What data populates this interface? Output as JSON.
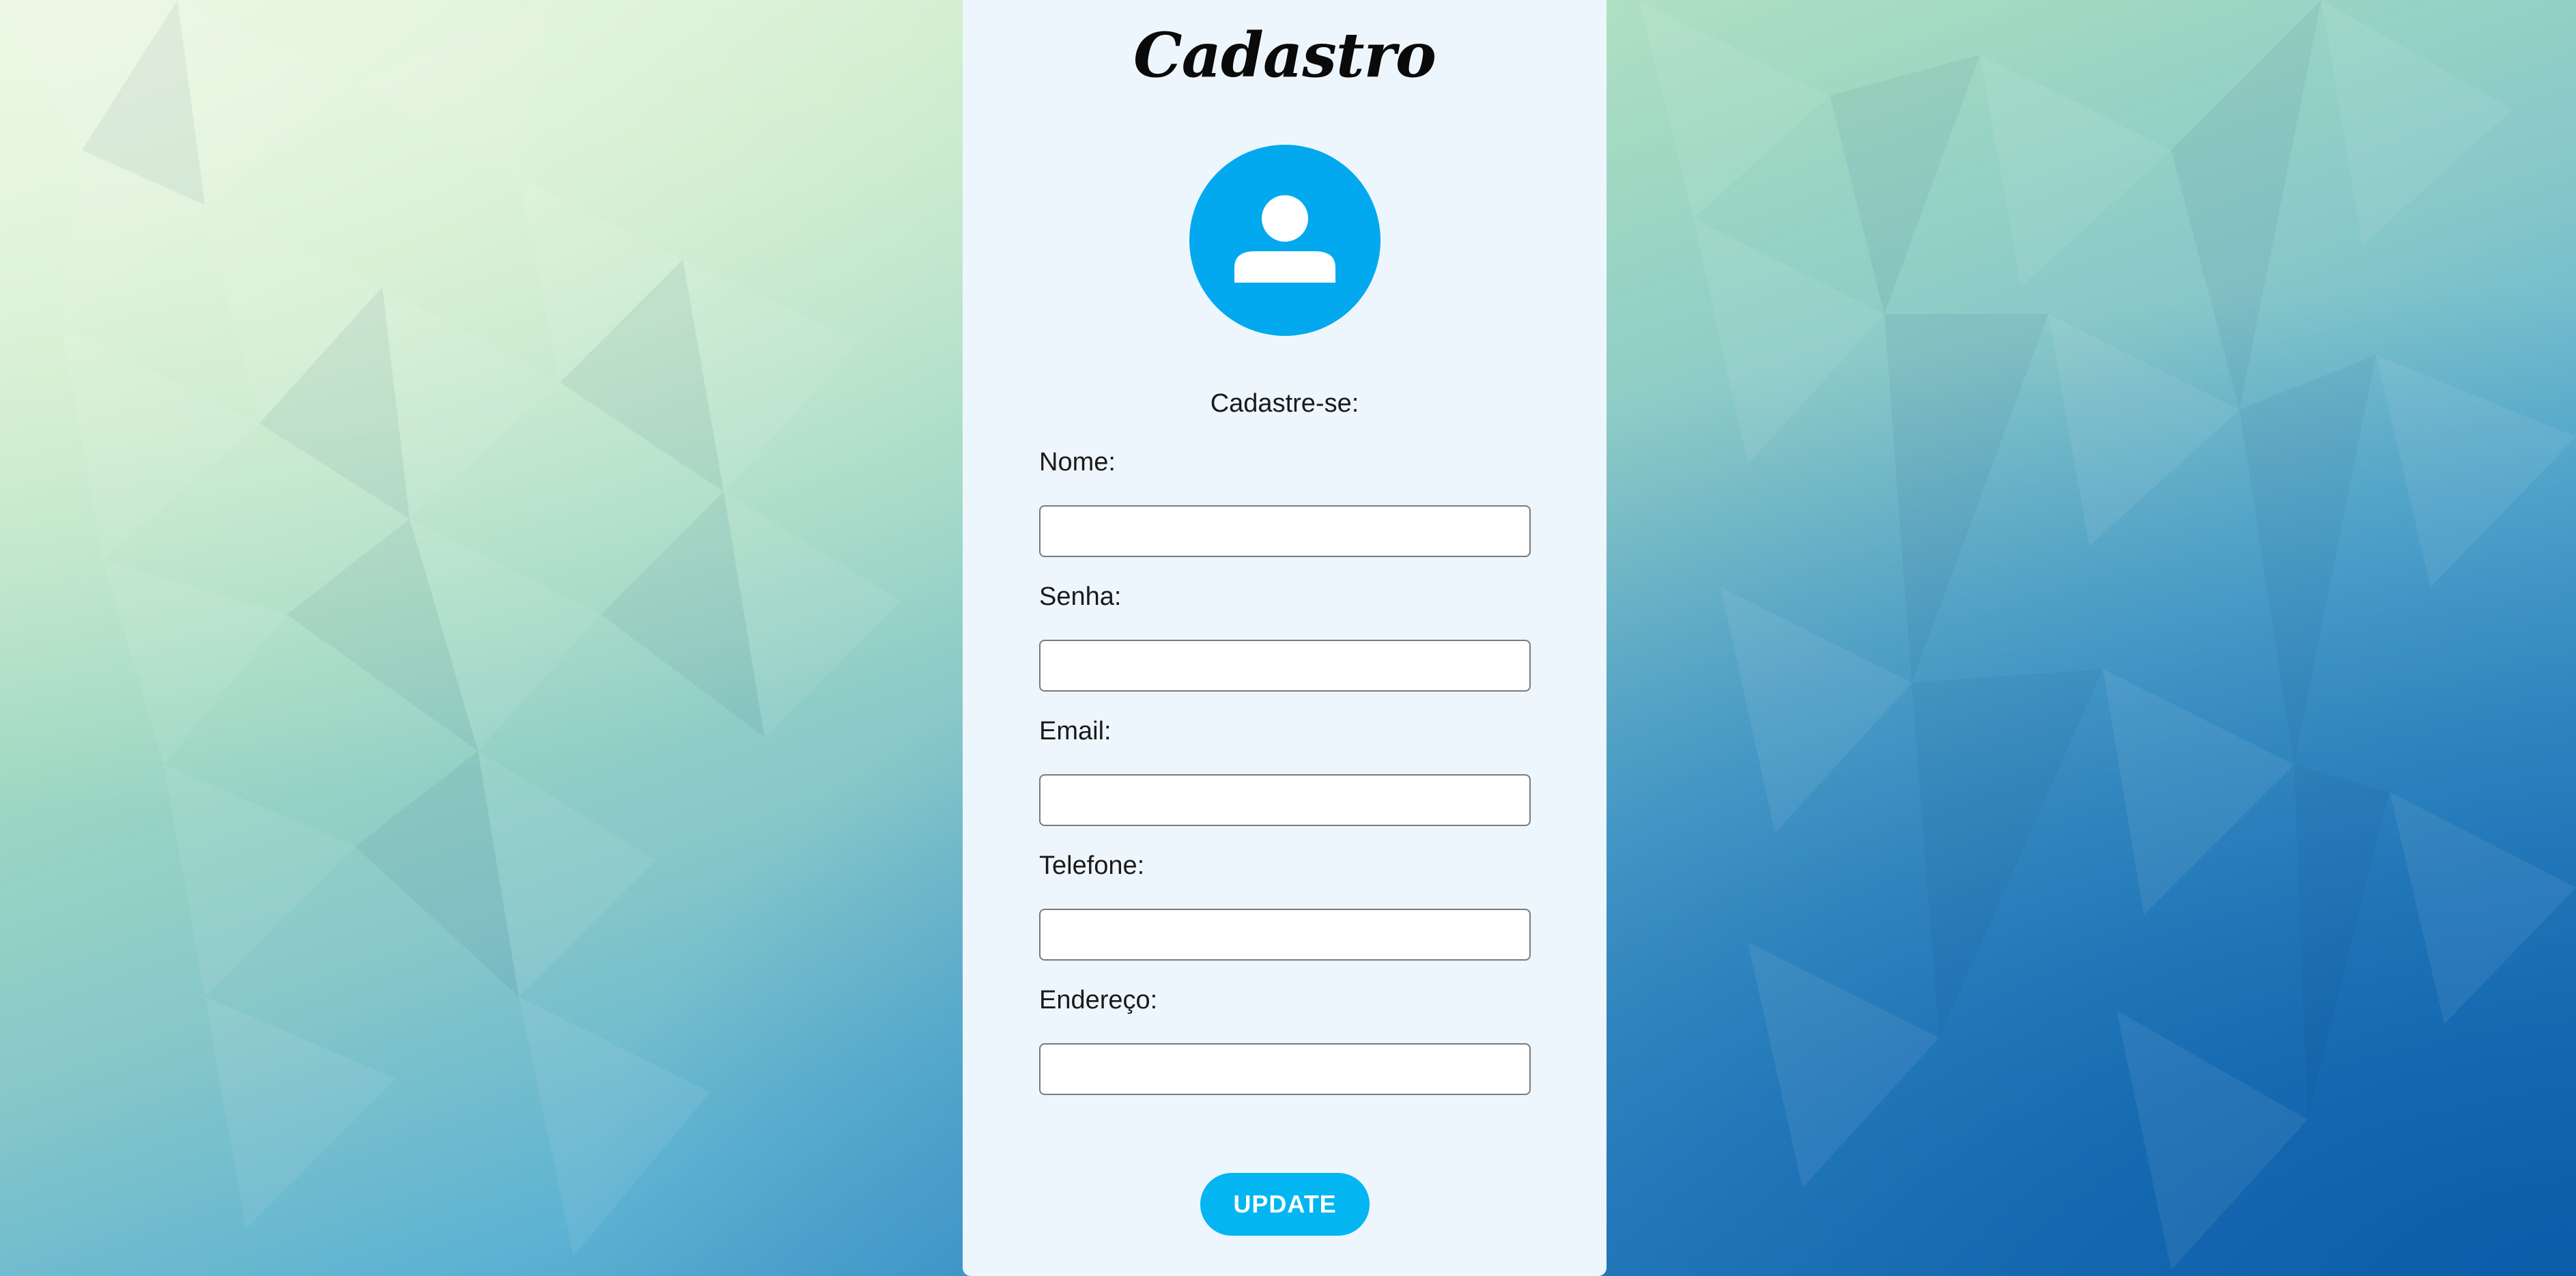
{
  "page": {
    "title": "Cadastro",
    "subtitle": "Cadastre-se:"
  },
  "form": {
    "fields": [
      {
        "label": "Nome:",
        "value": "",
        "placeholder": ""
      },
      {
        "label": "Senha:",
        "value": "",
        "placeholder": ""
      },
      {
        "label": "Email:",
        "value": "",
        "placeholder": ""
      },
      {
        "label": "Telefone:",
        "value": "",
        "placeholder": ""
      },
      {
        "label": "Endereço:",
        "value": "",
        "placeholder": ""
      }
    ],
    "submit_label": "UPDATE"
  },
  "icons": {
    "avatar": "user-icon"
  },
  "colors": {
    "accent": "#03a9ee",
    "button": "#03b6f2",
    "panel": "#eef6fd"
  }
}
